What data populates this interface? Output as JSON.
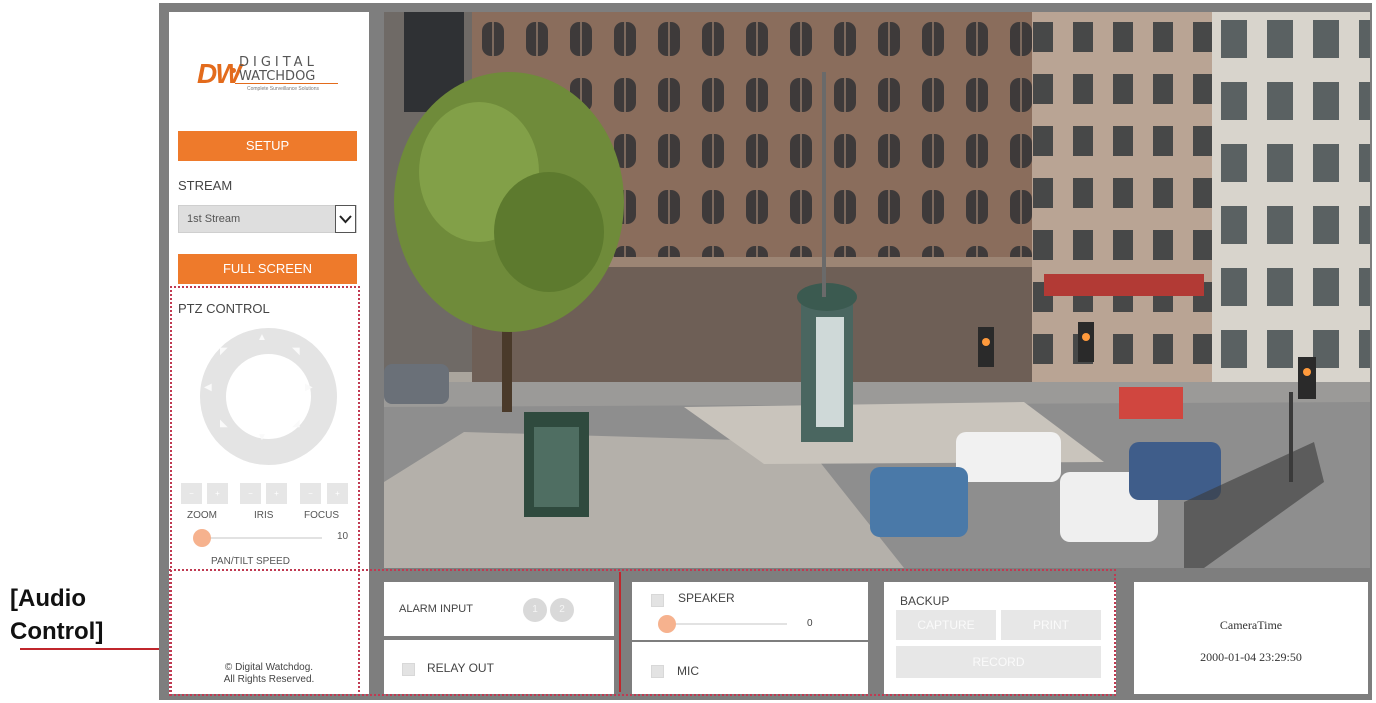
{
  "callout": {
    "label": "[Audio Control]"
  },
  "logo": {
    "brand_initials": "DW",
    "brand_line1": "DIGITAL",
    "brand_line2": "WATCHDOG",
    "tagline": "Complete Surveillance Solutions"
  },
  "sidebar": {
    "setup_label": "SETUP",
    "stream_heading": "STREAM",
    "stream_selected": "1st Stream",
    "fullscreen_label": "FULL SCREEN",
    "ptz_heading": "PTZ CONTROL",
    "zoom_label": "ZOOM",
    "iris_label": "IRIS",
    "focus_label": "FOCUS",
    "pan_tilt_value": "10",
    "pan_tilt_label": "PAN/TILT SPEED",
    "copyright_line1": "© Digital Watchdog.",
    "copyright_line2": "All Rights Reserved."
  },
  "alarm": {
    "alarm_input_label": "ALARM INPUT",
    "relay_out_label": "RELAY OUT"
  },
  "audio": {
    "speaker_label": "SPEAKER",
    "speaker_value": "0",
    "mic_label": "MIC"
  },
  "backup": {
    "heading": "BACKUP",
    "capture_label": "CAPTURE",
    "print_label": "PRINT",
    "record_label": "RECORD"
  },
  "camera_time": {
    "label": "CameraTime",
    "value": "2000-01-04 23:29:50"
  },
  "colors": {
    "accent": "#ee7a2b",
    "callout": "#c0262c",
    "frame": "#7e7e7e"
  }
}
